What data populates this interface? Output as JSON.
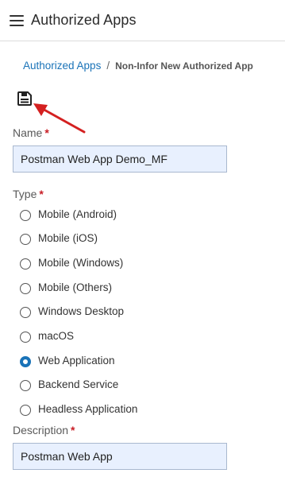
{
  "header": {
    "menu_icon": "hamburger-menu-icon",
    "title": "Authorized Apps"
  },
  "breadcrumb": {
    "link": "Authorized Apps",
    "separator": "/",
    "current": "Non-Infor New Authorized App"
  },
  "toolbar": {
    "save_icon": "floppy-disk-save-icon"
  },
  "form": {
    "name": {
      "label": "Name",
      "required_mark": "*",
      "value": "Postman Web App Demo_MF"
    },
    "type": {
      "label": "Type",
      "required_mark": "*",
      "selected": "Web Application",
      "options": [
        "Mobile (Android)",
        "Mobile (iOS)",
        "Mobile (Windows)",
        "Mobile (Others)",
        "Windows Desktop",
        "macOS",
        "Web Application",
        "Backend Service",
        "Headless Application"
      ]
    },
    "description": {
      "label": "Description",
      "required_mark": "*",
      "value": "Postman Web App"
    }
  },
  "colors": {
    "accent": "#1a73b8",
    "required": "#c81d25",
    "input_fill": "#e8f0fe",
    "annotation_arrow": "#d42020"
  }
}
